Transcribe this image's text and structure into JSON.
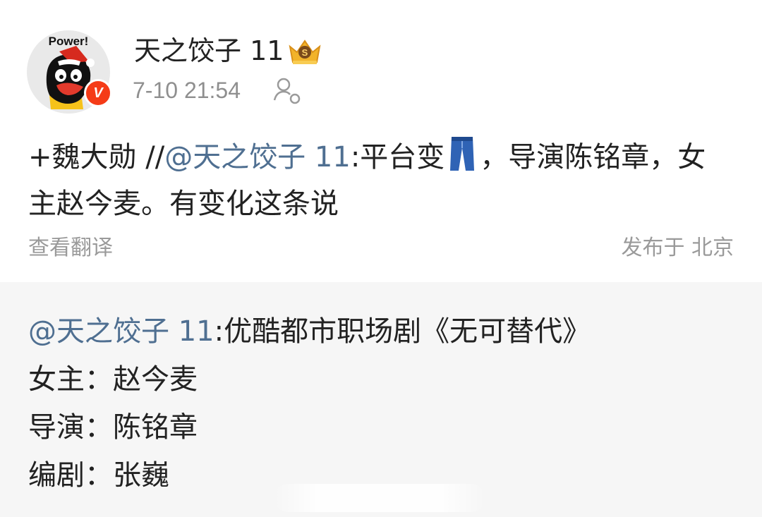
{
  "post": {
    "username": "天之饺子 11",
    "timestamp": "7-10 21:54",
    "content": {
      "prefix": "+魏大勋 //",
      "mention": "@天之饺子 11",
      "before_icon": ":平台变",
      "after_icon": "，导演陈铭章，女主赵今麦。有变化这条说"
    },
    "translate_label": "查看翻译",
    "location": "发布于 北京"
  },
  "avatar": {
    "text": "Power!"
  },
  "badge": {
    "verified_label": "V"
  },
  "icons": {
    "crown": "crown-level-icon",
    "follow": "follow-user-icon",
    "jeans": "jeans-emoji-icon"
  },
  "repost": {
    "mention": "@天之饺子 11",
    "title": ":优酷都市职场剧《无可替代》",
    "lines": [
      "女主：赵今麦",
      "导演：陈铭章",
      "编剧：张巍"
    ]
  },
  "colors": {
    "mention": "#4f6f91",
    "verified": "#f53b17",
    "meta_gray": "#8f8f8f",
    "repost_bg": "#f6f6f6"
  }
}
